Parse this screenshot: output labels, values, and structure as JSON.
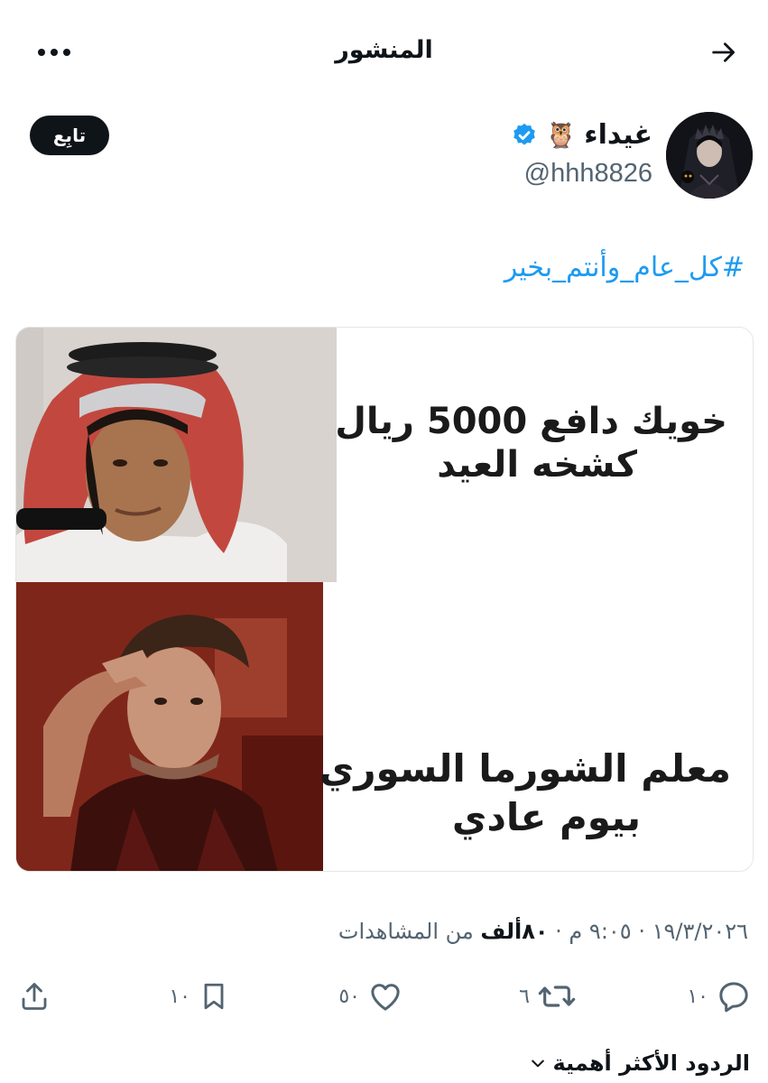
{
  "header": {
    "title": "المنشور"
  },
  "author": {
    "name": "غيداء",
    "emoji": "🦉",
    "handle": "@hhh8826",
    "follow_label": "تابِع"
  },
  "post": {
    "hashtag": "#كل_عام_وأنتم_بخير",
    "meme": {
      "caption_top_line1": "خويك دافع 5000 ريال",
      "caption_top_line2": "كشخه العيد",
      "caption_bottom_line1": "معلم الشورما السوري",
      "caption_bottom_line2": "بيوم عادي"
    },
    "date": "١٩/٣/٢٠٢٦",
    "time": "٩:٠٥ م",
    "views_count": "٨٠ألف",
    "views_label": "من المشاهدات"
  },
  "actions": {
    "replies": "١٠",
    "reposts": "٦",
    "likes": "٥٠",
    "bookmarks": "١٠"
  },
  "replies_sort": {
    "label": "الردود الأكثر أهمية"
  },
  "colors": {
    "accent": "#1d9bf0",
    "text": "#0f1419",
    "muted": "#536471"
  }
}
